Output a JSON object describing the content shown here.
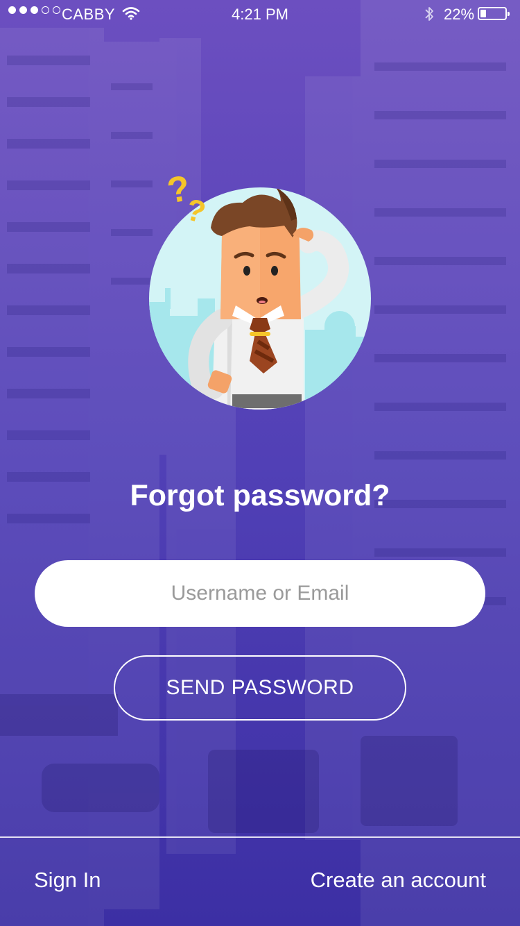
{
  "status_bar": {
    "carrier": "CABBY",
    "time": "4:21 PM",
    "battery_percent": "22%",
    "battery_level": 0.22,
    "signal_strength": "3 of 5"
  },
  "main": {
    "title": "Forgot password?",
    "username_field": {
      "placeholder": "Username or Email",
      "value": ""
    },
    "send_button_label": "SEND PASSWORD"
  },
  "footer": {
    "sign_in_label": "Sign In",
    "create_account_label": "Create an account"
  },
  "icons": [
    "wifi-icon",
    "bluetooth-icon",
    "battery-icon",
    "signal-dots-icon"
  ],
  "colors": {
    "background_top": "#6a4fbf",
    "background_bottom": "#3a2fa3",
    "field_background": "#ffffff",
    "illustration_circle": "#d3f4f6",
    "question_marks": "#f5c52a"
  }
}
